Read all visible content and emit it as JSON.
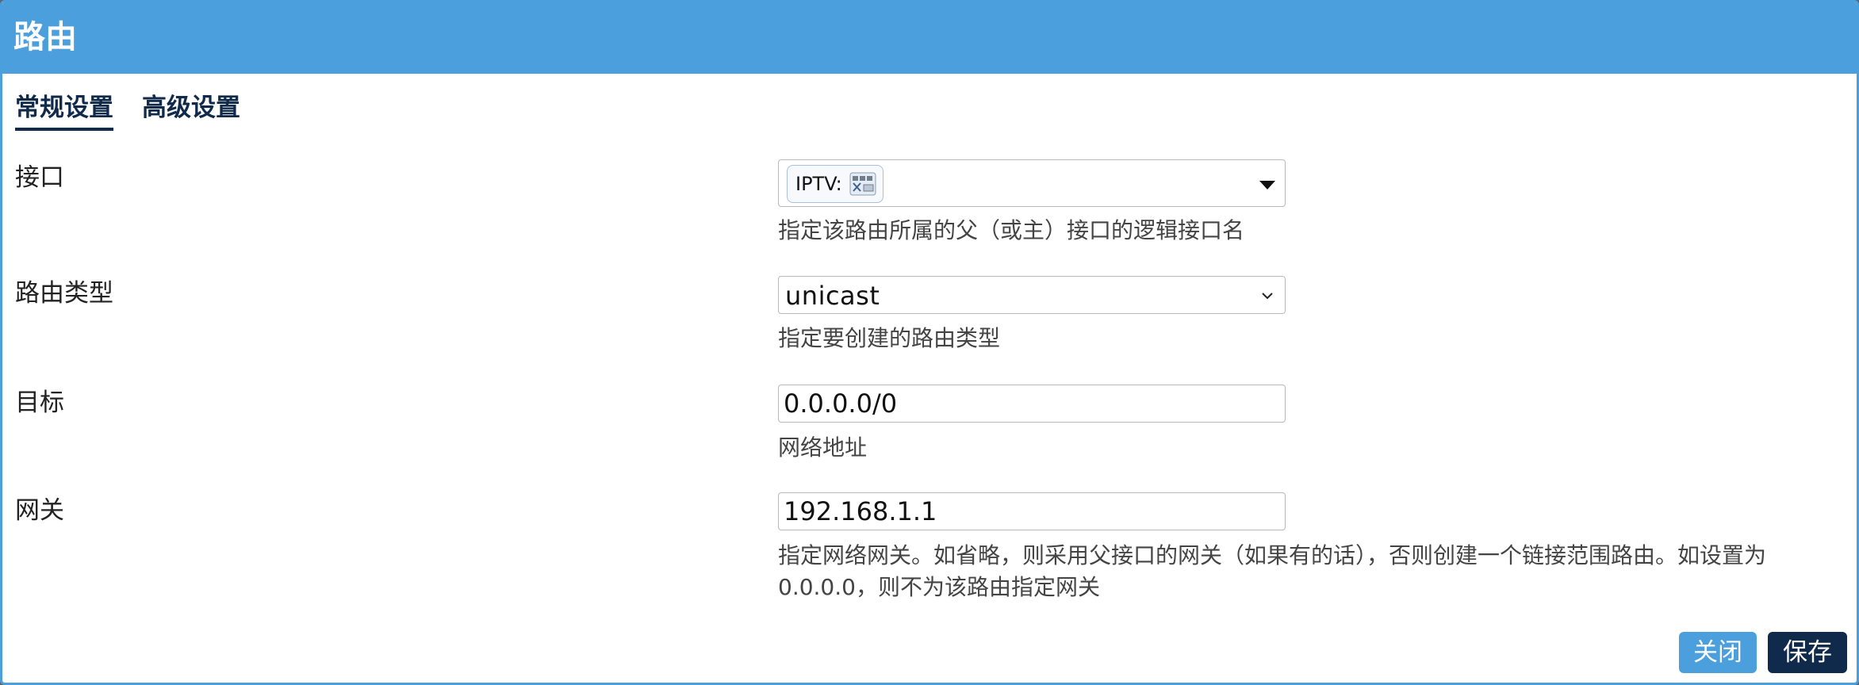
{
  "dialog": {
    "title": "路由"
  },
  "tabs": [
    {
      "label": "常规设置",
      "active": true
    },
    {
      "label": "高级设置",
      "active": false
    }
  ],
  "fields": {
    "interface": {
      "label": "接口",
      "value": "IPTV:",
      "help": "指定该路由所属的父（或主）接口的逻辑接口名"
    },
    "route_type": {
      "label": "路由类型",
      "value": "unicast",
      "help": "指定要创建的路由类型"
    },
    "target": {
      "label": "目标",
      "value": "0.0.0.0/0",
      "help": "网络地址"
    },
    "gateway": {
      "label": "网关",
      "value": "192.168.1.1",
      "help_line1": "指定网络网关。如省略，则采用父接口的网关（如果有的话），否则创建一个链接范围路由。如设置为",
      "help_line2": "0.0.0.0，则不为该路由指定网关"
    }
  },
  "buttons": {
    "close": "关闭",
    "save": "保存"
  },
  "colors": {
    "header": "#4a9fdc",
    "dark_navy": "#0f2a4a",
    "close_button": "#4a9fdc"
  }
}
